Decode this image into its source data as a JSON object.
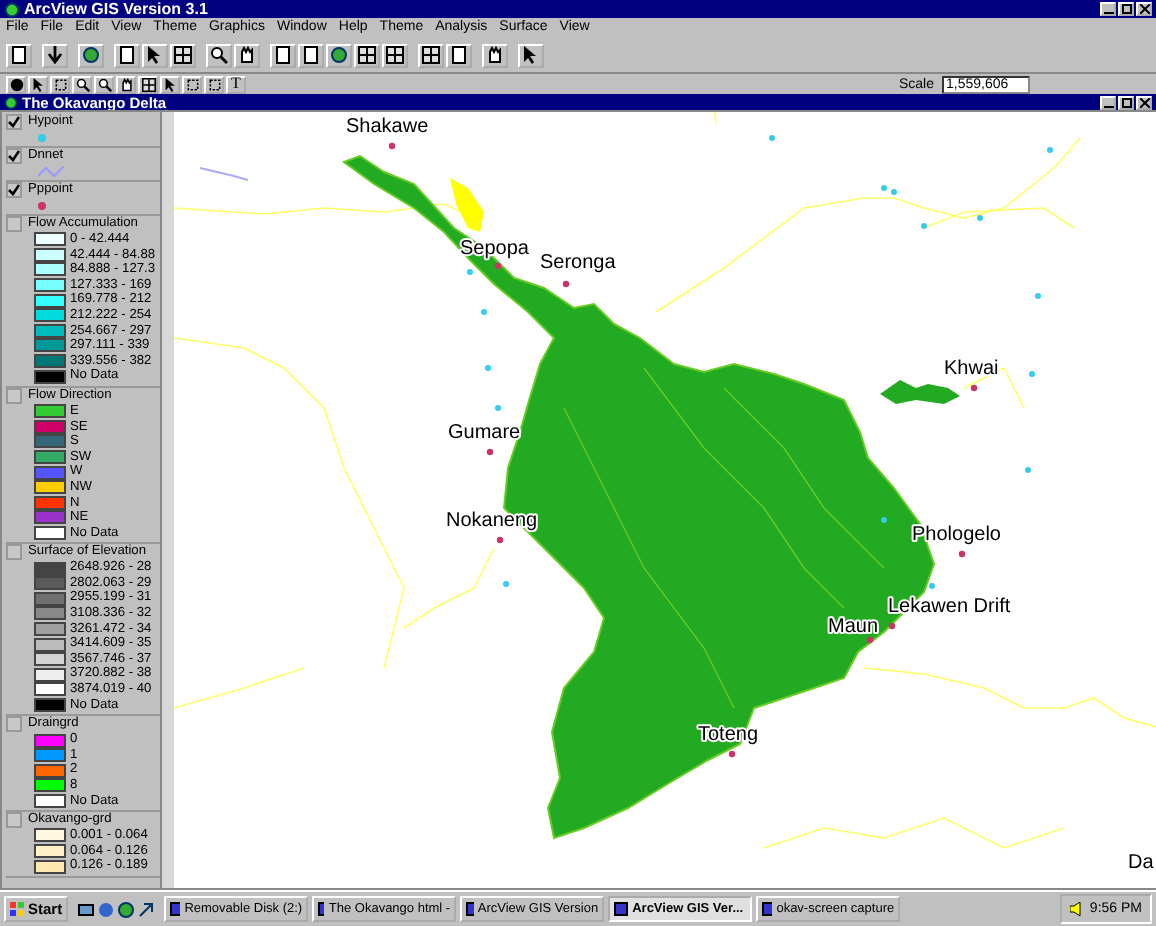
{
  "window": {
    "title": "ArcView GIS Version 3.1"
  },
  "menu": [
    "File",
    "File",
    "Edit",
    "View",
    "Theme",
    "Graphics",
    "Window",
    "Help",
    "Theme",
    "Analysis",
    "Surface",
    "View"
  ],
  "toolbar": {
    "text_tool": "T",
    "scale_label": "Scale",
    "scale_value": "1,559,606"
  },
  "view": {
    "title": "The Okavango Delta"
  },
  "legend": {
    "themes": [
      {
        "name": "Hypoint",
        "visible": true,
        "kind": "point",
        "color": "#33ccee"
      },
      {
        "name": "Dnnet",
        "visible": true,
        "kind": "line",
        "color": "#9999ff"
      },
      {
        "name": "Pppoint",
        "visible": true,
        "kind": "point",
        "color": "#cc3366"
      },
      {
        "name": "Flow Accumulation",
        "visible": false,
        "kind": "classes",
        "classes": [
          {
            "label": "0 - 42.444",
            "color": "#eeffff"
          },
          {
            "label": "42.444 - 84.88",
            "color": "#ccffff"
          },
          {
            "label": "84.888 - 127.3",
            "color": "#aaffff"
          },
          {
            "label": "127.333 - 169",
            "color": "#77ffff"
          },
          {
            "label": "169.778 - 212",
            "color": "#33ffff"
          },
          {
            "label": "212.222 - 254",
            "color": "#00dddd"
          },
          {
            "label": "254.667 - 297",
            "color": "#00bbbb"
          },
          {
            "label": "297.111 - 339",
            "color": "#009999"
          },
          {
            "label": "339.556 - 382",
            "color": "#007777"
          },
          {
            "label": "No Data",
            "color": "#000000"
          }
        ]
      },
      {
        "name": "Flow Direction",
        "visible": false,
        "kind": "classes",
        "classes": [
          {
            "label": "E",
            "color": "#33cc33"
          },
          {
            "label": "SE",
            "color": "#cc0066"
          },
          {
            "label": "S",
            "color": "#336677"
          },
          {
            "label": "SW",
            "color": "#33aa66"
          },
          {
            "label": "W",
            "color": "#5555ff"
          },
          {
            "label": "NW",
            "color": "#ffcc00"
          },
          {
            "label": "N",
            "color": "#ff3300"
          },
          {
            "label": "NE",
            "color": "#9933cc"
          },
          {
            "label": "No Data",
            "color": "#ffffff"
          }
        ]
      },
      {
        "name": "Surface of Elevation",
        "visible": false,
        "kind": "classes",
        "classes": [
          {
            "label": "2648.926 - 28",
            "color": "#444444"
          },
          {
            "label": "2802.063 - 29",
            "color": "#5a5a5a"
          },
          {
            "label": "2955.199 - 31",
            "color": "#707070"
          },
          {
            "label": "3108.336 - 32",
            "color": "#888888"
          },
          {
            "label": "3261.472 - 34",
            "color": "#a0a0a0"
          },
          {
            "label": "3414.609 - 35",
            "color": "#bbbbbb"
          },
          {
            "label": "3567.746 - 37",
            "color": "#d4d4d4"
          },
          {
            "label": "3720.882 - 38",
            "color": "#eeeeee"
          },
          {
            "label": "3874.019 - 40",
            "color": "#ffffff"
          },
          {
            "label": "No Data",
            "color": "#000000"
          }
        ]
      },
      {
        "name": "Draingrd",
        "visible": false,
        "kind": "classes",
        "classes": [
          {
            "label": "0",
            "color": "#ff00ff"
          },
          {
            "label": "1",
            "color": "#0099ff"
          },
          {
            "label": "2",
            "color": "#ff6600"
          },
          {
            "label": "8",
            "color": "#00ff00"
          },
          {
            "label": "No Data",
            "color": "#ffffff"
          }
        ]
      },
      {
        "name": "Okavango-grd",
        "visible": false,
        "kind": "classes",
        "classes": [
          {
            "label": "0.001 - 0.064",
            "color": "#fff8e0"
          },
          {
            "label": "0.064 - 0.126",
            "color": "#fff0c8"
          },
          {
            "label": "0.126 - 0.189",
            "color": "#ffe8b0"
          }
        ]
      }
    ]
  },
  "map": {
    "places": [
      {
        "name": "Shakawe",
        "kind": "town"
      },
      {
        "name": "Sepopa",
        "kind": "town"
      },
      {
        "name": "Seronga",
        "kind": "town"
      },
      {
        "name": "Khwai",
        "kind": "town"
      },
      {
        "name": "Gumare",
        "kind": "town"
      },
      {
        "name": "Nokaneng",
        "kind": "town"
      },
      {
        "name": "Phologelo",
        "kind": "town"
      },
      {
        "name": "Lekawen Drift",
        "kind": "town"
      },
      {
        "name": "Maun",
        "kind": "town"
      },
      {
        "name": "Toteng",
        "kind": "town"
      },
      {
        "name": "Da",
        "kind": "label"
      }
    ]
  },
  "taskbar": {
    "start": "Start",
    "tasks": [
      {
        "label": "Removable Disk (2:)",
        "selected": false
      },
      {
        "label": "The Okavango html -",
        "selected": false
      },
      {
        "label": "ArcView GIS Version",
        "selected": false
      },
      {
        "label": "ArcView GIS Ver...",
        "selected": true
      },
      {
        "label": "okav-screen capture",
        "selected": false
      }
    ],
    "clock": "9:56 PM"
  }
}
